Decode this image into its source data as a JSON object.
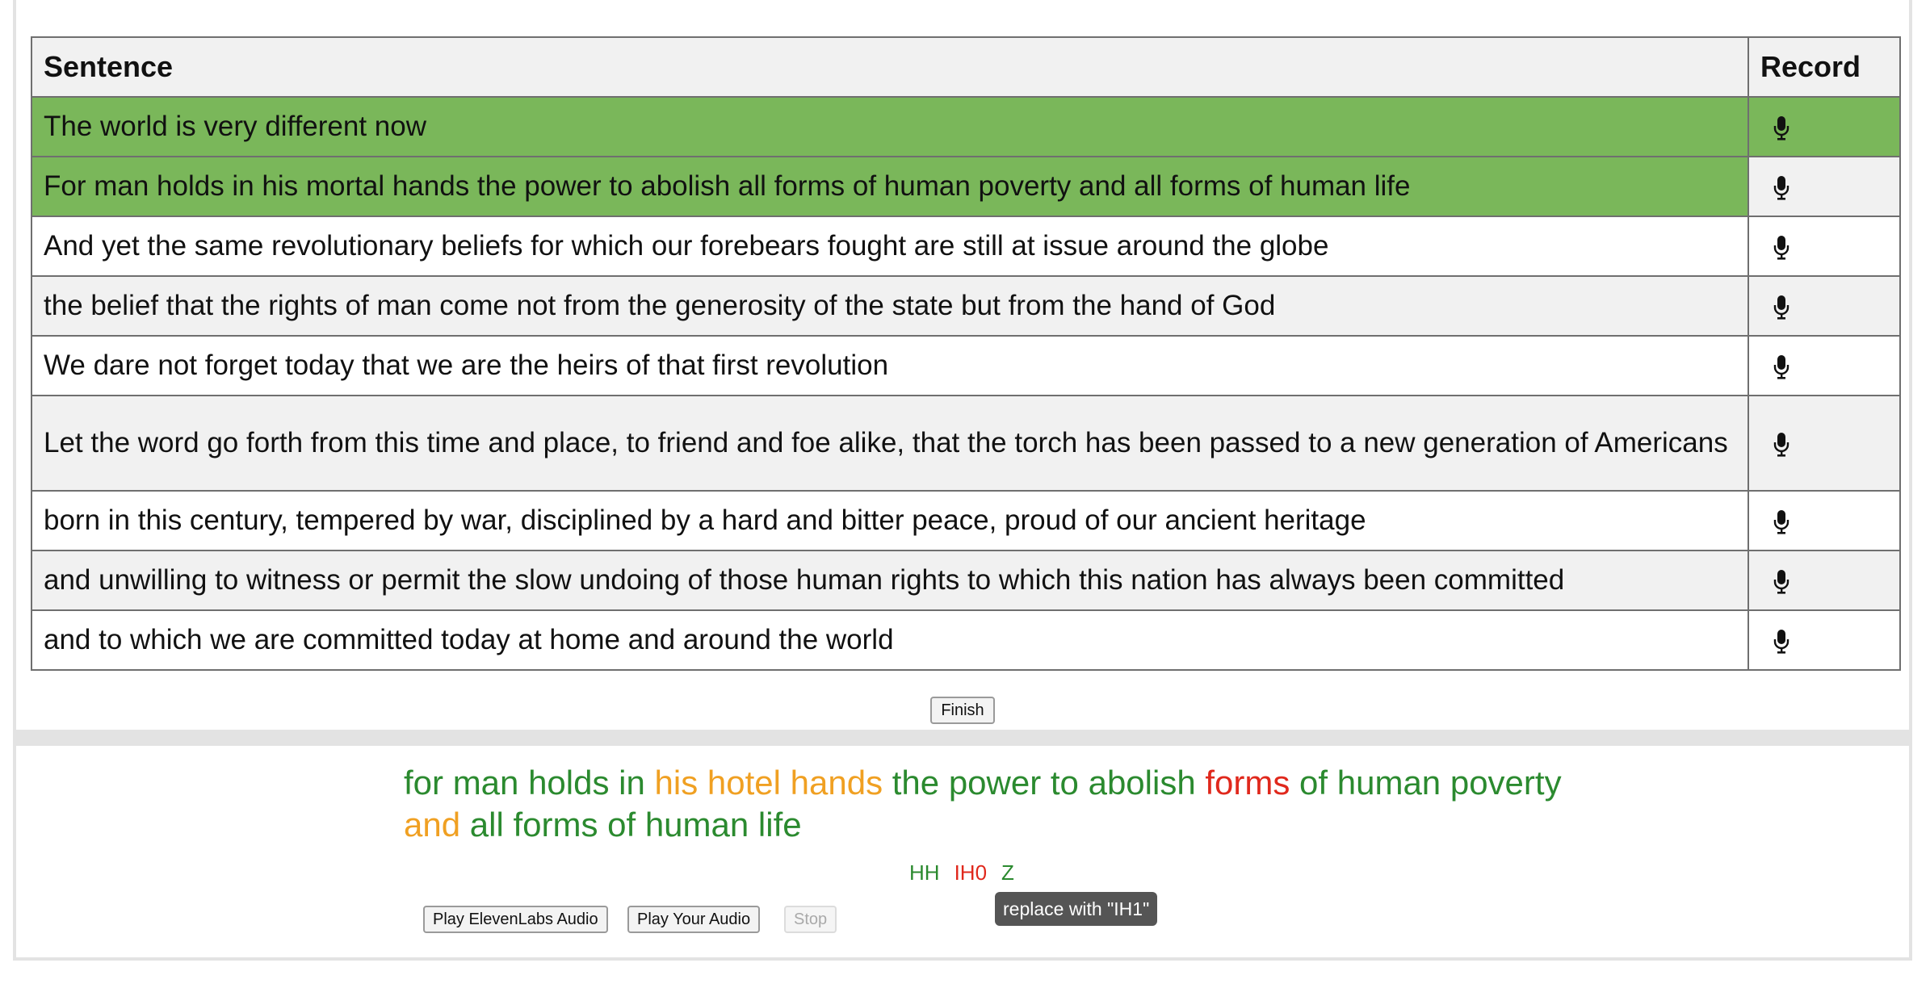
{
  "table": {
    "headers": {
      "sentence": "Sentence",
      "record": "Record"
    },
    "rows": [
      {
        "text": "The world is very different now",
        "status": "done-full"
      },
      {
        "text": "For man holds in his mortal hands the power to abolish all forms of human poverty and all forms of human life",
        "status": "done"
      },
      {
        "text": "And yet the same revolutionary beliefs for which our forebears fought are still at issue around the globe",
        "status": "pending"
      },
      {
        "text": "the belief that the rights of man come not from the generosity of the state but from the hand of God",
        "status": "pending"
      },
      {
        "text": "We dare not forget today that we are the heirs of that first revolution",
        "status": "pending"
      },
      {
        "text": "Let the word go forth from this time and place, to friend and foe alike, that the torch has been passed to a new generation of Americans",
        "status": "pending"
      },
      {
        "text": "born in this century, tempered by war, disciplined by a hard and bitter peace, proud of our ancient heritage",
        "status": "pending"
      },
      {
        "text": "and unwilling to witness or permit the slow undoing of those human rights to which this nation has always been committed",
        "status": "pending"
      },
      {
        "text": "and to which we are committed today at home and around the world",
        "status": "pending"
      }
    ]
  },
  "finish_label": "Finish",
  "analysis": {
    "words": [
      {
        "w": "for",
        "s": "good"
      },
      {
        "w": "man",
        "s": "good"
      },
      {
        "w": "holds",
        "s": "good"
      },
      {
        "w": "in",
        "s": "good"
      },
      {
        "w": "his",
        "s": "warn"
      },
      {
        "w": "hotel",
        "s": "warn"
      },
      {
        "w": "hands",
        "s": "warn"
      },
      {
        "w": "the",
        "s": "good"
      },
      {
        "w": "power",
        "s": "good"
      },
      {
        "w": "to",
        "s": "good"
      },
      {
        "w": "abolish",
        "s": "good"
      },
      {
        "w": "forms",
        "s": "bad"
      },
      {
        "w": "of",
        "s": "good"
      },
      {
        "w": "human",
        "s": "good"
      },
      {
        "w": "poverty",
        "s": "good"
      },
      {
        "w": "and",
        "s": "warn"
      },
      {
        "w": "all",
        "s": "good"
      },
      {
        "w": "forms",
        "s": "good"
      },
      {
        "w": "of",
        "s": "good"
      },
      {
        "w": "human",
        "s": "good"
      },
      {
        "w": "life",
        "s": "good"
      }
    ],
    "phonemes": [
      {
        "p": "HH",
        "s": "good"
      },
      {
        "p": "IH0",
        "s": "bad"
      },
      {
        "p": "Z",
        "s": "good"
      }
    ],
    "tooltip": "replace with \"IH1\""
  },
  "audio": {
    "play_elevenlabs": "Play ElevenLabs Audio",
    "play_yours": "Play Your Audio",
    "stop": "Stop"
  },
  "colors": {
    "done_row": "#7ab75a",
    "good": "#2b8a2f",
    "warn": "#f0a022",
    "bad": "#e0281c"
  },
  "icons": {
    "record": "microphone-icon"
  }
}
